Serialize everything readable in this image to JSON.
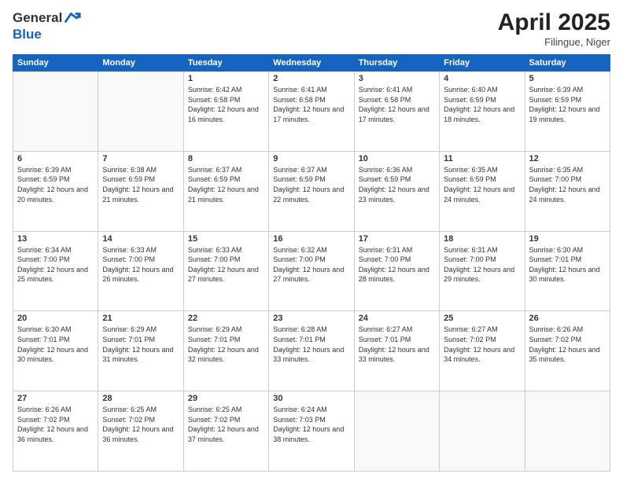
{
  "header": {
    "logo_general": "General",
    "logo_blue": "Blue",
    "month_title": "April 2025",
    "subtitle": "Filingue, Niger"
  },
  "days_of_week": [
    "Sunday",
    "Monday",
    "Tuesday",
    "Wednesday",
    "Thursday",
    "Friday",
    "Saturday"
  ],
  "weeks": [
    [
      {
        "day": "",
        "info": ""
      },
      {
        "day": "",
        "info": ""
      },
      {
        "day": "1",
        "info": "Sunrise: 6:42 AM\nSunset: 6:58 PM\nDaylight: 12 hours and 16 minutes."
      },
      {
        "day": "2",
        "info": "Sunrise: 6:41 AM\nSunset: 6:58 PM\nDaylight: 12 hours and 17 minutes."
      },
      {
        "day": "3",
        "info": "Sunrise: 6:41 AM\nSunset: 6:58 PM\nDaylight: 12 hours and 17 minutes."
      },
      {
        "day": "4",
        "info": "Sunrise: 6:40 AM\nSunset: 6:59 PM\nDaylight: 12 hours and 18 minutes."
      },
      {
        "day": "5",
        "info": "Sunrise: 6:39 AM\nSunset: 6:59 PM\nDaylight: 12 hours and 19 minutes."
      }
    ],
    [
      {
        "day": "6",
        "info": "Sunrise: 6:39 AM\nSunset: 6:59 PM\nDaylight: 12 hours and 20 minutes."
      },
      {
        "day": "7",
        "info": "Sunrise: 6:38 AM\nSunset: 6:59 PM\nDaylight: 12 hours and 21 minutes."
      },
      {
        "day": "8",
        "info": "Sunrise: 6:37 AM\nSunset: 6:59 PM\nDaylight: 12 hours and 21 minutes."
      },
      {
        "day": "9",
        "info": "Sunrise: 6:37 AM\nSunset: 6:59 PM\nDaylight: 12 hours and 22 minutes."
      },
      {
        "day": "10",
        "info": "Sunrise: 6:36 AM\nSunset: 6:59 PM\nDaylight: 12 hours and 23 minutes."
      },
      {
        "day": "11",
        "info": "Sunrise: 6:35 AM\nSunset: 6:59 PM\nDaylight: 12 hours and 24 minutes."
      },
      {
        "day": "12",
        "info": "Sunrise: 6:35 AM\nSunset: 7:00 PM\nDaylight: 12 hours and 24 minutes."
      }
    ],
    [
      {
        "day": "13",
        "info": "Sunrise: 6:34 AM\nSunset: 7:00 PM\nDaylight: 12 hours and 25 minutes."
      },
      {
        "day": "14",
        "info": "Sunrise: 6:33 AM\nSunset: 7:00 PM\nDaylight: 12 hours and 26 minutes."
      },
      {
        "day": "15",
        "info": "Sunrise: 6:33 AM\nSunset: 7:00 PM\nDaylight: 12 hours and 27 minutes."
      },
      {
        "day": "16",
        "info": "Sunrise: 6:32 AM\nSunset: 7:00 PM\nDaylight: 12 hours and 27 minutes."
      },
      {
        "day": "17",
        "info": "Sunrise: 6:31 AM\nSunset: 7:00 PM\nDaylight: 12 hours and 28 minutes."
      },
      {
        "day": "18",
        "info": "Sunrise: 6:31 AM\nSunset: 7:00 PM\nDaylight: 12 hours and 29 minutes."
      },
      {
        "day": "19",
        "info": "Sunrise: 6:30 AM\nSunset: 7:01 PM\nDaylight: 12 hours and 30 minutes."
      }
    ],
    [
      {
        "day": "20",
        "info": "Sunrise: 6:30 AM\nSunset: 7:01 PM\nDaylight: 12 hours and 30 minutes."
      },
      {
        "day": "21",
        "info": "Sunrise: 6:29 AM\nSunset: 7:01 PM\nDaylight: 12 hours and 31 minutes."
      },
      {
        "day": "22",
        "info": "Sunrise: 6:29 AM\nSunset: 7:01 PM\nDaylight: 12 hours and 32 minutes."
      },
      {
        "day": "23",
        "info": "Sunrise: 6:28 AM\nSunset: 7:01 PM\nDaylight: 12 hours and 33 minutes."
      },
      {
        "day": "24",
        "info": "Sunrise: 6:27 AM\nSunset: 7:01 PM\nDaylight: 12 hours and 33 minutes."
      },
      {
        "day": "25",
        "info": "Sunrise: 6:27 AM\nSunset: 7:02 PM\nDaylight: 12 hours and 34 minutes."
      },
      {
        "day": "26",
        "info": "Sunrise: 6:26 AM\nSunset: 7:02 PM\nDaylight: 12 hours and 35 minutes."
      }
    ],
    [
      {
        "day": "27",
        "info": "Sunrise: 6:26 AM\nSunset: 7:02 PM\nDaylight: 12 hours and 36 minutes."
      },
      {
        "day": "28",
        "info": "Sunrise: 6:25 AM\nSunset: 7:02 PM\nDaylight: 12 hours and 36 minutes."
      },
      {
        "day": "29",
        "info": "Sunrise: 6:25 AM\nSunset: 7:02 PM\nDaylight: 12 hours and 37 minutes."
      },
      {
        "day": "30",
        "info": "Sunrise: 6:24 AM\nSunset: 7:03 PM\nDaylight: 12 hours and 38 minutes."
      },
      {
        "day": "",
        "info": ""
      },
      {
        "day": "",
        "info": ""
      },
      {
        "day": "",
        "info": ""
      }
    ]
  ]
}
